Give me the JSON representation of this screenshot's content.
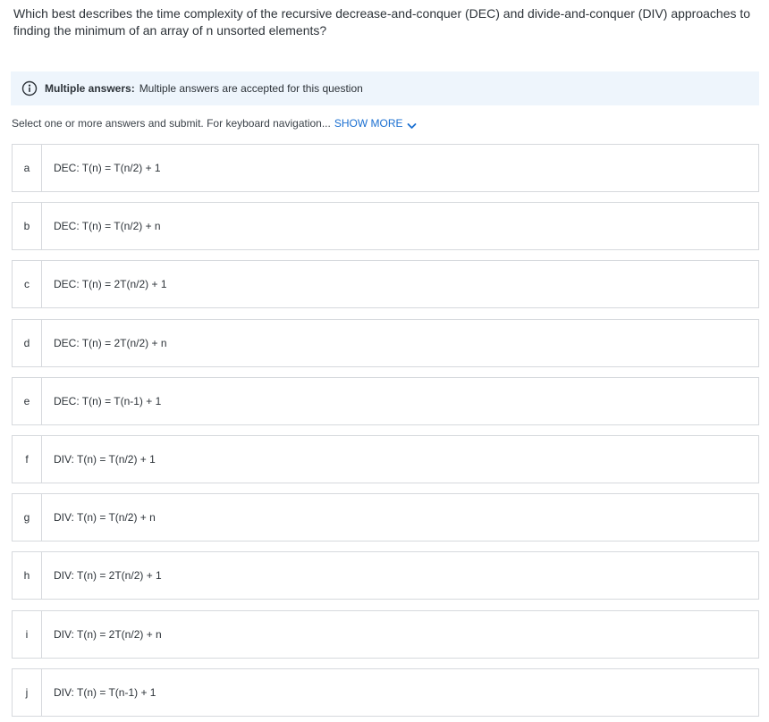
{
  "question": {
    "text": "Which best describes the time complexity of the recursive decrease-and-conquer (DEC) and divide-and-conquer (DIV) approaches to finding the minimum of an array of n unsorted elements?"
  },
  "notice": {
    "icon": "info-icon",
    "label": "Multiple answers:",
    "text": "Multiple answers are accepted for this question",
    "background": "#eef5fc"
  },
  "instructions": {
    "text": "Select one or more answers and submit. For keyboard navigation...",
    "show_more": "SHOW MORE",
    "show_more_color": "#1a6fd1"
  },
  "options": [
    {
      "letter": "a",
      "text": "DEC: T(n) = T(n/2) + 1"
    },
    {
      "letter": "b",
      "text": "DEC: T(n) = T(n/2) + n"
    },
    {
      "letter": "c",
      "text": "DEC: T(n) = 2T(n/2) + 1"
    },
    {
      "letter": "d",
      "text": "DEC: T(n) = 2T(n/2) + n"
    },
    {
      "letter": "e",
      "text": "DEC: T(n) = T(n-1) + 1"
    },
    {
      "letter": "f",
      "text": "DIV: T(n) = T(n/2) + 1"
    },
    {
      "letter": "g",
      "text": "DIV: T(n) = T(n/2) + n"
    },
    {
      "letter": "h",
      "text": "DIV: T(n) = 2T(n/2) + 1"
    },
    {
      "letter": "i",
      "text": "DIV: T(n) = 2T(n/2) + n"
    },
    {
      "letter": "j",
      "text": "DIV: T(n) = T(n-1) + 1"
    }
  ]
}
